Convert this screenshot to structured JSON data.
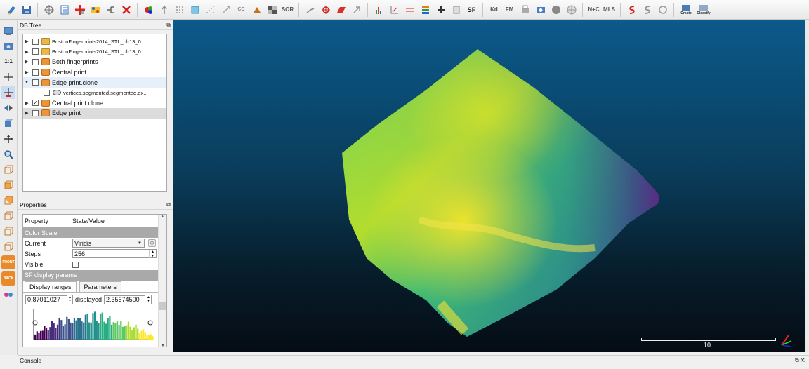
{
  "db_tree": {
    "title": "DB Tree",
    "float_icon": "float-icon",
    "items": [
      {
        "label": "BostonFingerprints2014_STL_ph13_0...",
        "type": "folder",
        "checked": false,
        "expanded": false,
        "level": 0
      },
      {
        "label": "BostonFingerprints2014_STL_ph13_0...",
        "type": "folder",
        "checked": false,
        "expanded": false,
        "level": 0
      },
      {
        "label": "Both fingerprints",
        "type": "mesh",
        "checked": false,
        "expanded": false,
        "level": 0
      },
      {
        "label": "Central print",
        "type": "mesh",
        "checked": false,
        "expanded": false,
        "level": 0
      },
      {
        "label": "Edge print.clone",
        "type": "mesh",
        "checked": false,
        "expanded": true,
        "level": 0
      },
      {
        "label": "vertices.segmented.segmented.ex...",
        "type": "cloud",
        "checked": false,
        "expanded": false,
        "level": 1
      },
      {
        "label": "Central print.clone",
        "type": "mesh",
        "checked": true,
        "expanded": false,
        "level": 0
      },
      {
        "label": "Edge print",
        "type": "mesh",
        "checked": false,
        "expanded": false,
        "level": 0
      }
    ]
  },
  "properties": {
    "title": "Properties",
    "header": {
      "property": "Property",
      "value": "State/Value"
    },
    "color_scale_section": "Color Scale",
    "current_label": "Current",
    "current_value": "Viridis",
    "steps_label": "Steps",
    "steps_value": "256",
    "visible_label": "Visible",
    "visible_checked": false,
    "sf_section": "SF display params",
    "tabs": [
      "Display ranges",
      "Parameters"
    ],
    "active_tab": "Display ranges",
    "range_min": "0.87011027",
    "displayed_label": "displayed",
    "range_max": "2.35674500"
  },
  "viewer": {
    "scale_label": "10"
  },
  "console": {
    "title": "Console"
  },
  "toolbar": {
    "top_icons": [
      "open-icon",
      "save-icon",
      "sep",
      "translate-rotate-icon",
      "list-icon",
      "clone-icon",
      "merge-icon",
      "segment-icon",
      "delete-icon",
      "sep",
      "color-icon",
      "normals-icon",
      "sample-icon",
      "octree-icon",
      "noise-icon",
      "resize-icon",
      "cc-icon",
      "drape-icon",
      "checker-icon",
      "sor-icon",
      "sep",
      "pick-icon",
      "align-icon",
      "cut-icon",
      "register-icon",
      "sep",
      "histogram-icon",
      "distance-icon",
      "cloud-mesh-dist-icon",
      "stats-icon",
      "plus-icon",
      "sf-ops-icon",
      "sf-icon",
      "sep",
      "kd-icon",
      "fm-icon",
      "print-icon",
      "camera-icon",
      "sphere-icon",
      "mesh-sphere-icon",
      "sep",
      "nc-icon",
      "mls-icon",
      "sep",
      "s-icon",
      "s2-icon",
      "export-icon",
      "sep",
      "canupo-create-icon",
      "canupo-classify-icon"
    ],
    "labels": {
      "sor": "SOR",
      "sf": "SF",
      "kd": "Kd",
      "fm": "FM",
      "nc": "N+C",
      "mls": "MLS",
      "canupo_create": "Create",
      "canupo_classify": "Classify"
    },
    "left_icons": [
      "view-3d-icon",
      "camera-icon",
      "one-to-one-icon",
      "center-icon",
      "auto-pick-icon",
      "arrows-icon",
      "cube-view-icon",
      "move-icon",
      "zoom-icon",
      "front-view-icon",
      "back-view-icon",
      "left-view-icon",
      "right-view-icon",
      "top-view-icon",
      "bottom-view-icon",
      "iso-front-icon",
      "iso-back-icon",
      "stereo-icon"
    ],
    "left_labels": {
      "one_to_one": "1:1",
      "front": "FRONT",
      "back": "BACK"
    }
  }
}
